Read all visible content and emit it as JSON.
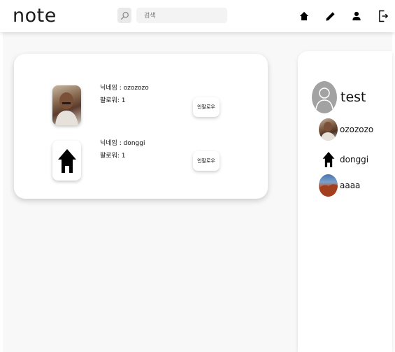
{
  "header": {
    "logo": "note",
    "search": {
      "placeholder": "검색",
      "value": ""
    }
  },
  "nav": {
    "icons": [
      "home-icon",
      "pencil-icon",
      "user-icon",
      "logout-icon"
    ]
  },
  "following": [
    {
      "nickname": "닉네임 : ozozozo",
      "followers": "팔로워: 1",
      "button": "언팔로우",
      "avatar": "photo"
    },
    {
      "nickname": "닉네임 : donggi",
      "followers": "팔로워: 1",
      "button": "언팔로우",
      "avatar": "home-icon"
    }
  ],
  "sidebar": {
    "me": {
      "name": "test",
      "avatar": "default-user-icon"
    },
    "friends": [
      {
        "name": "ozozozo",
        "avatar": "photo"
      },
      {
        "name": "donggi",
        "avatar": "home-icon"
      },
      {
        "name": "aaaa",
        "avatar": "landscape-photo"
      }
    ]
  },
  "colors": {
    "background": "#f8f8f8",
    "card": "#ffffff",
    "avatar_placeholder": "#a2a2a2"
  }
}
